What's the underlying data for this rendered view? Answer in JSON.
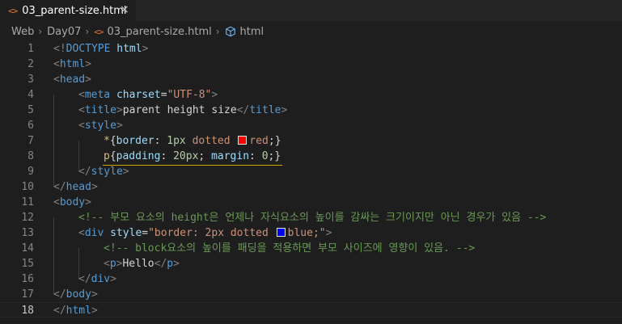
{
  "tab": {
    "icon": "<>",
    "title": "03_parent-size.html",
    "close": "×"
  },
  "breadcrumb": {
    "items": [
      "Web",
      "Day07",
      "03_parent-size.html",
      "html"
    ],
    "separator": "›",
    "file_icon": "<>",
    "element_icon": "cube-icon"
  },
  "colors": {
    "background": "#1e1e1e",
    "tag": "#569cd6",
    "attribute": "#9cdcfe",
    "string": "#ce9178",
    "comment": "#6a9955",
    "css_selector": "#d7ba7d",
    "warning_underline": "#cca700"
  },
  "editor": {
    "current_line": 18,
    "lines": [
      {
        "n": "1",
        "indent": 0,
        "tokens": [
          {
            "t": "punc",
            "v": "<!"
          },
          {
            "t": "tag",
            "v": "DOCTYPE"
          },
          {
            "t": "txt",
            "v": " "
          },
          {
            "t": "attr",
            "v": "html"
          },
          {
            "t": "punc",
            "v": ">"
          }
        ]
      },
      {
        "n": "2",
        "indent": 0,
        "tokens": [
          {
            "t": "punc",
            "v": "<"
          },
          {
            "t": "tag",
            "v": "html"
          },
          {
            "t": "punc",
            "v": ">"
          }
        ]
      },
      {
        "n": "3",
        "indent": 0,
        "tokens": [
          {
            "t": "punc",
            "v": "<"
          },
          {
            "t": "tag",
            "v": "head"
          },
          {
            "t": "punc",
            "v": ">"
          }
        ]
      },
      {
        "n": "4",
        "indent": 1,
        "tokens": [
          {
            "t": "punc",
            "v": "<"
          },
          {
            "t": "tag",
            "v": "meta"
          },
          {
            "t": "txt",
            "v": " "
          },
          {
            "t": "attr",
            "v": "charset"
          },
          {
            "t": "txt",
            "v": "="
          },
          {
            "t": "str",
            "v": "\"UTF-8\""
          },
          {
            "t": "punc",
            "v": ">"
          }
        ]
      },
      {
        "n": "5",
        "indent": 1,
        "tokens": [
          {
            "t": "punc",
            "v": "<"
          },
          {
            "t": "tag",
            "v": "title"
          },
          {
            "t": "punc",
            "v": ">"
          },
          {
            "t": "txt",
            "v": "parent height size"
          },
          {
            "t": "punc",
            "v": "</"
          },
          {
            "t": "tag",
            "v": "title"
          },
          {
            "t": "punc",
            "v": ">"
          }
        ]
      },
      {
        "n": "6",
        "indent": 1,
        "tokens": [
          {
            "t": "punc",
            "v": "<"
          },
          {
            "t": "tag",
            "v": "style"
          },
          {
            "t": "punc",
            "v": ">"
          }
        ]
      },
      {
        "n": "7",
        "indent": 2,
        "tokens": [
          {
            "t": "sel",
            "v": "*"
          },
          {
            "t": "txt",
            "v": "{"
          },
          {
            "t": "prop",
            "v": "border"
          },
          {
            "t": "txt",
            "v": ": "
          },
          {
            "t": "num",
            "v": "1px"
          },
          {
            "t": "txt",
            "v": " "
          },
          {
            "t": "val",
            "v": "dotted"
          },
          {
            "t": "txt",
            "v": " "
          },
          {
            "t": "swatch",
            "v": "#ff0000"
          },
          {
            "t": "val",
            "v": "red"
          },
          {
            "t": "txt",
            "v": ";}"
          }
        ]
      },
      {
        "n": "8",
        "indent": 2,
        "tokens": [
          {
            "t": "sel",
            "v": "p"
          },
          {
            "t": "txt",
            "v": "{"
          },
          {
            "t": "prop",
            "v": "padding"
          },
          {
            "t": "txt",
            "v": ": "
          },
          {
            "t": "num",
            "v": "20px"
          },
          {
            "t": "txt",
            "v": "; "
          },
          {
            "t": "prop",
            "v": "margin"
          },
          {
            "t": "txt",
            "v": ": "
          },
          {
            "t": "num",
            "v": "0"
          },
          {
            "t": "txt",
            "v": ";}"
          }
        ]
      },
      {
        "n": "9",
        "indent": 1,
        "tokens": [
          {
            "t": "punc",
            "v": "</"
          },
          {
            "t": "tag",
            "v": "style"
          },
          {
            "t": "punc",
            "v": ">"
          }
        ]
      },
      {
        "n": "10",
        "indent": 0,
        "tokens": [
          {
            "t": "punc",
            "v": "</"
          },
          {
            "t": "tag",
            "v": "head"
          },
          {
            "t": "punc",
            "v": ">"
          }
        ]
      },
      {
        "n": "11",
        "indent": 0,
        "tokens": [
          {
            "t": "punc",
            "v": "<"
          },
          {
            "t": "tag",
            "v": "body"
          },
          {
            "t": "punc",
            "v": ">"
          }
        ]
      },
      {
        "n": "12",
        "indent": 1,
        "tokens": [
          {
            "t": "cmt",
            "v": "<!-- 부모 요소의 height은 언제나 자식요소의 높이를 감싸는 크기이지만 아닌 경우가 있음 -->"
          }
        ]
      },
      {
        "n": "13",
        "indent": 1,
        "tokens": [
          {
            "t": "punc",
            "v": "<"
          },
          {
            "t": "tag",
            "v": "div"
          },
          {
            "t": "txt",
            "v": " "
          },
          {
            "t": "attr",
            "v": "style"
          },
          {
            "t": "txt",
            "v": "="
          },
          {
            "t": "str",
            "v": "\"border: 2px dotted "
          },
          {
            "t": "swatch",
            "v": "#0000ff"
          },
          {
            "t": "str",
            "v": "blue;\""
          },
          {
            "t": "punc",
            "v": ">"
          }
        ]
      },
      {
        "n": "14",
        "indent": 2,
        "tokens": [
          {
            "t": "cmt",
            "v": "<!-- block요소의 높이를 패딩을 적용하면 부모 사이즈에 영향이 있음. -->"
          }
        ]
      },
      {
        "n": "15",
        "indent": 2,
        "tokens": [
          {
            "t": "punc",
            "v": "<"
          },
          {
            "t": "tag",
            "v": "p"
          },
          {
            "t": "punc",
            "v": ">"
          },
          {
            "t": "txt",
            "v": "Hello"
          },
          {
            "t": "punc",
            "v": "</"
          },
          {
            "t": "tag",
            "v": "p"
          },
          {
            "t": "punc",
            "v": ">"
          }
        ]
      },
      {
        "n": "16",
        "indent": 1,
        "tokens": [
          {
            "t": "punc",
            "v": "</"
          },
          {
            "t": "tag",
            "v": "div"
          },
          {
            "t": "punc",
            "v": ">"
          }
        ]
      },
      {
        "n": "17",
        "indent": 0,
        "tokens": [
          {
            "t": "punc",
            "v": "</"
          },
          {
            "t": "tag",
            "v": "body"
          },
          {
            "t": "punc",
            "v": ">"
          }
        ]
      },
      {
        "n": "18",
        "indent": 0,
        "tokens": [
          {
            "t": "punc",
            "v": "</"
          },
          {
            "t": "tag",
            "v": "html"
          },
          {
            "t": "punc",
            "v": ">"
          }
        ]
      }
    ]
  }
}
